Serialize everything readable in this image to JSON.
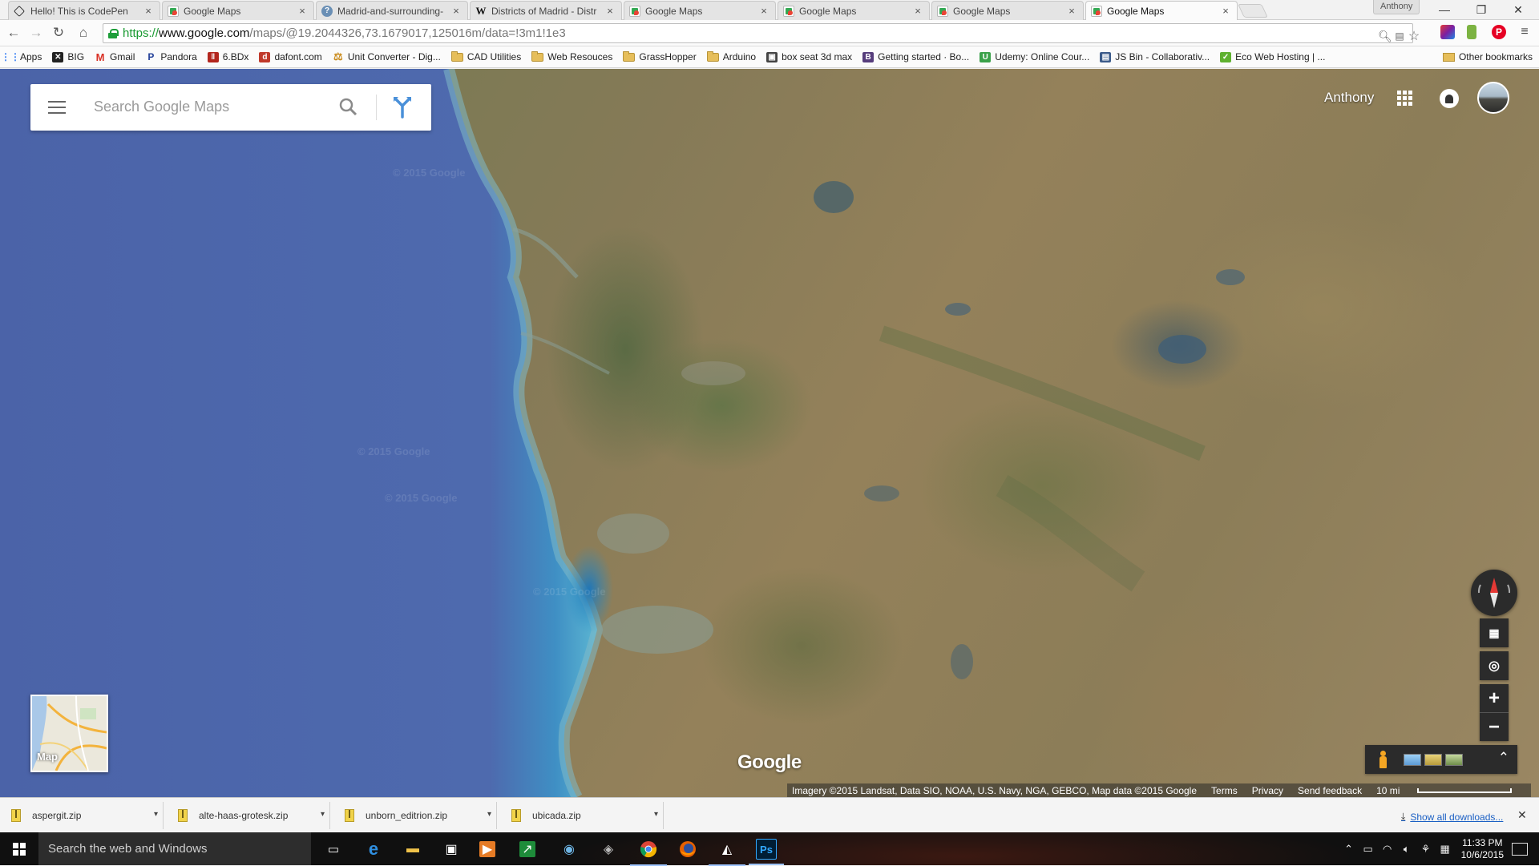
{
  "browser": {
    "tabs": [
      {
        "title": "Hello! This is CodePen",
        "icon": "codepen-icon",
        "active": false
      },
      {
        "title": "Google Maps",
        "icon": "google-maps-icon",
        "active": false
      },
      {
        "title": "Madrid-and-surrounding-",
        "icon": "page-icon",
        "active": false
      },
      {
        "title": "Districts of Madrid - Distr",
        "icon": "wikipedia-icon",
        "active": false
      },
      {
        "title": "Google Maps",
        "icon": "google-maps-icon",
        "active": false
      },
      {
        "title": "Google Maps",
        "icon": "google-maps-icon",
        "active": false
      },
      {
        "title": "Google Maps",
        "icon": "google-maps-icon",
        "active": false
      },
      {
        "title": "Google Maps",
        "icon": "google-maps-icon",
        "active": true
      }
    ],
    "profile_name": "Anthony",
    "url": {
      "scheme": "https://",
      "host": "www.google.com",
      "path": "/maps/@19.2044326,73.1679017,125016m/data=!3m1!1e3"
    },
    "bookmarks": [
      {
        "label": "Apps",
        "icon": "apps-grid-icon",
        "color": "#4285f4"
      },
      {
        "label": "BIG",
        "icon": "big-icon",
        "color": "#222222"
      },
      {
        "label": "Gmail",
        "icon": "gmail-icon",
        "color": "#d93025"
      },
      {
        "label": "Pandora",
        "icon": "pandora-icon",
        "color": "#224099"
      },
      {
        "label": "6.BDx",
        "icon": "6bdx-icon",
        "color": "#b3261e"
      },
      {
        "label": "dafont.com",
        "icon": "dafont-icon",
        "color": "#c0392b"
      },
      {
        "label": "Unit Converter - Dig...",
        "icon": "unit-converter-icon",
        "color": "#c98a1a"
      },
      {
        "label": "CAD Utilities",
        "icon": "folder-icon",
        "folder": true
      },
      {
        "label": "Web Resouces",
        "icon": "folder-icon",
        "folder": true
      },
      {
        "label": "GrassHopper",
        "icon": "folder-icon",
        "folder": true
      },
      {
        "label": "Arduino",
        "icon": "folder-icon",
        "folder": true
      },
      {
        "label": "box seat 3d max",
        "icon": "3dmax-icon",
        "color": "#444444"
      },
      {
        "label": "Getting started · Bo...",
        "icon": "bootstrap-icon",
        "color": "#563d7c"
      },
      {
        "label": "Udemy: Online Cour...",
        "icon": "udemy-icon",
        "color": "#3aa14a"
      },
      {
        "label": "JS Bin - Collaborativ...",
        "icon": "jsbin-icon",
        "color": "#3b5b8a"
      },
      {
        "label": "Eco Web Hosting | ...",
        "icon": "eco-hosting-icon",
        "color": "#5fb130"
      }
    ],
    "other_bookmarks": "Other bookmarks"
  },
  "maps": {
    "search_placeholder": "Search Google Maps",
    "account_name": "Anthony",
    "watermarks": [
      "© 2015 Google",
      "© 2015 Google",
      "© 2015 Google",
      "© 2015 Google"
    ],
    "map_type_label": "Map",
    "logo": "Google",
    "attribution": "Imagery ©2015 Landsat, Data SIO, NOAA, U.S. Navy, NGA, GEBCO, Map data ©2015 Google",
    "links": [
      "Terms",
      "Privacy",
      "Send feedback"
    ],
    "scale_label": "10 mi"
  },
  "downloads": {
    "items": [
      "aspergit.zip",
      "alte-haas-grotesk.zip",
      "unborn_editrion.zip",
      "ubicada.zip"
    ],
    "show_all": "Show all downloads..."
  },
  "taskbar": {
    "search_placeholder": "Search the web and Windows",
    "time": "11:33 PM",
    "date": "10/6/2015"
  }
}
